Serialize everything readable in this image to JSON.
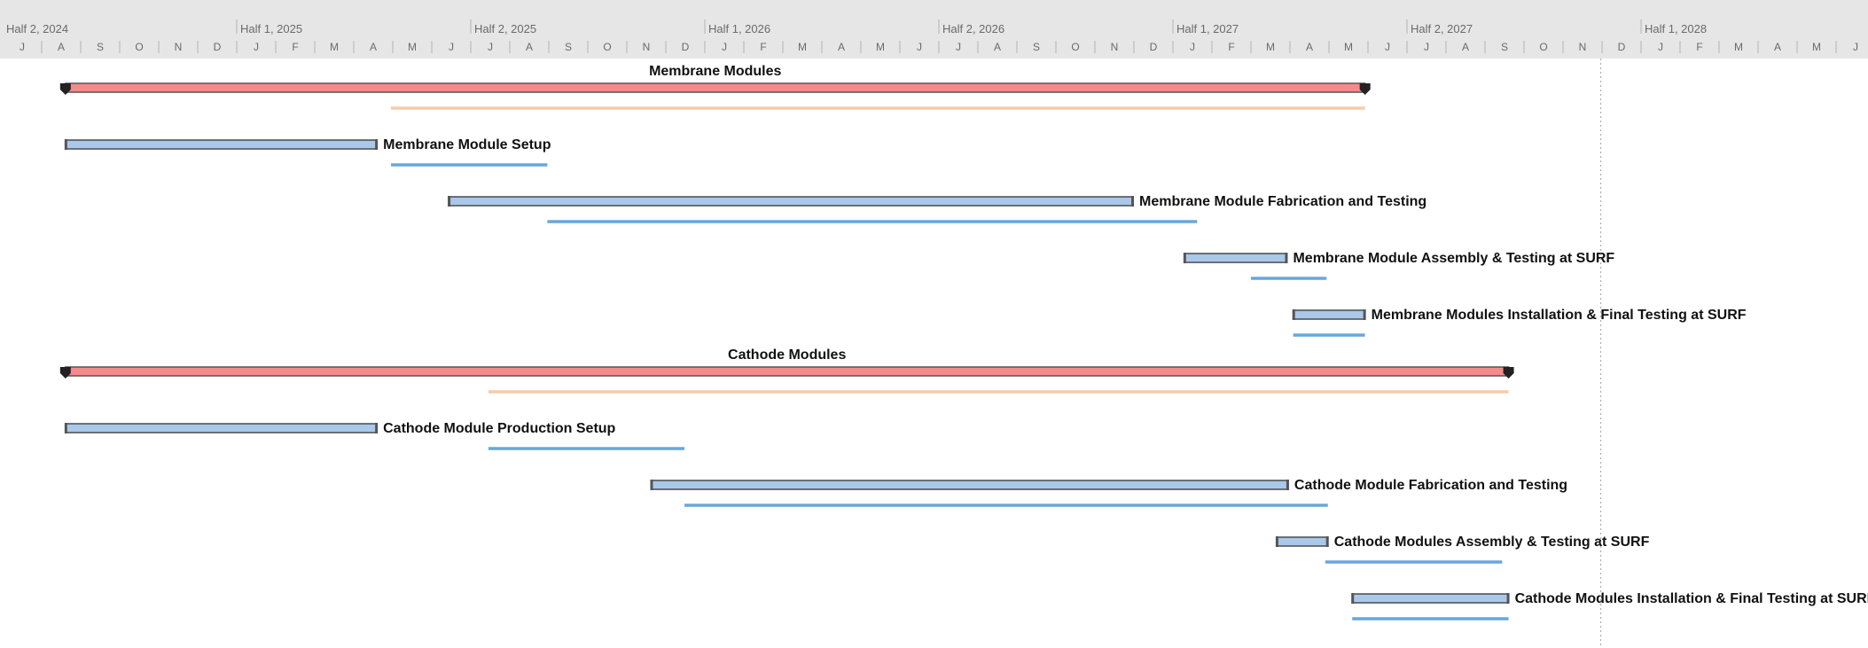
{
  "chart_data": {
    "type": "gantt",
    "x_start": "2024-06-01",
    "x_end": "2028-07-31",
    "status_date": "2027-10-31",
    "colors": {
      "task_bar": "#a9c8ea",
      "summary_bar": "#f58a8a",
      "task_baseline": "#6aa6dc",
      "summary_baseline": "#f7cba8"
    },
    "timescale": {
      "halves": [
        "Half 2, 2024",
        "Half 1, 2025",
        "Half 2, 2025",
        "Half 1, 2026",
        "Half 2, 2026",
        "Half 1, 2027",
        "Half 2, 2027",
        "Half 1, 2028"
      ],
      "months": [
        "J",
        "A",
        "S",
        "O",
        "N",
        "D",
        "J",
        "F",
        "M",
        "A",
        "M",
        "J",
        "J",
        "A",
        "S",
        "O",
        "N",
        "D",
        "J",
        "F",
        "M",
        "A",
        "M",
        "J",
        "J",
        "A",
        "S",
        "O",
        "N",
        "D",
        "J",
        "F",
        "M",
        "A",
        "M",
        "J",
        "J",
        "A",
        "S",
        "O",
        "N",
        "D",
        "J",
        "F",
        "M",
        "A",
        "M",
        "J"
      ]
    },
    "tasks": [
      {
        "name": "Membrane Modules",
        "summary": true,
        "start": "2024-07-20",
        "end": "2027-04-30",
        "baseline_start": "2025-03-31",
        "baseline_end": "2027-04-30"
      },
      {
        "name": "Membrane Module Setup",
        "summary": false,
        "start": "2024-07-20",
        "end": "2025-03-20",
        "baseline_start": "2025-03-31",
        "baseline_end": "2025-07-31"
      },
      {
        "name": "Membrane Module Fabrication and Testing",
        "summary": false,
        "start": "2025-05-15",
        "end": "2026-10-31",
        "baseline_start": "2025-07-31",
        "baseline_end": "2026-12-20"
      },
      {
        "name": "Membrane Module Assembly & Testing at SURF",
        "summary": false,
        "start": "2026-12-10",
        "end": "2027-02-28",
        "baseline_start": "2027-01-31",
        "baseline_end": "2027-03-31"
      },
      {
        "name": "Membrane Modules Installation & Final Testing at SURF",
        "summary": false,
        "start": "2027-03-05",
        "end": "2027-04-30",
        "baseline_start": "2027-03-05",
        "baseline_end": "2027-04-30"
      },
      {
        "name": "Cathode Modules",
        "summary": true,
        "start": "2024-07-20",
        "end": "2027-08-20",
        "baseline_start": "2025-06-15",
        "baseline_end": "2027-08-20"
      },
      {
        "name": "Cathode Module Production Setup",
        "summary": false,
        "start": "2024-07-20",
        "end": "2025-03-20",
        "baseline_start": "2025-06-15",
        "baseline_end": "2025-11-15"
      },
      {
        "name": "Cathode Module Fabrication and Testing",
        "summary": false,
        "start": "2025-10-20",
        "end": "2027-03-01",
        "baseline_start": "2025-11-15",
        "baseline_end": "2027-04-01"
      },
      {
        "name": "Cathode Modules Assembly & Testing at SURF",
        "summary": false,
        "start": "2027-02-20",
        "end": "2027-04-01",
        "baseline_start": "2027-03-30",
        "baseline_end": "2027-08-15"
      },
      {
        "name": "Cathode Modules Installation & Final Testing at SURF",
        "summary": false,
        "start": "2027-04-20",
        "end": "2027-08-20",
        "baseline_start": "2027-04-20",
        "baseline_end": "2027-08-20"
      }
    ]
  }
}
